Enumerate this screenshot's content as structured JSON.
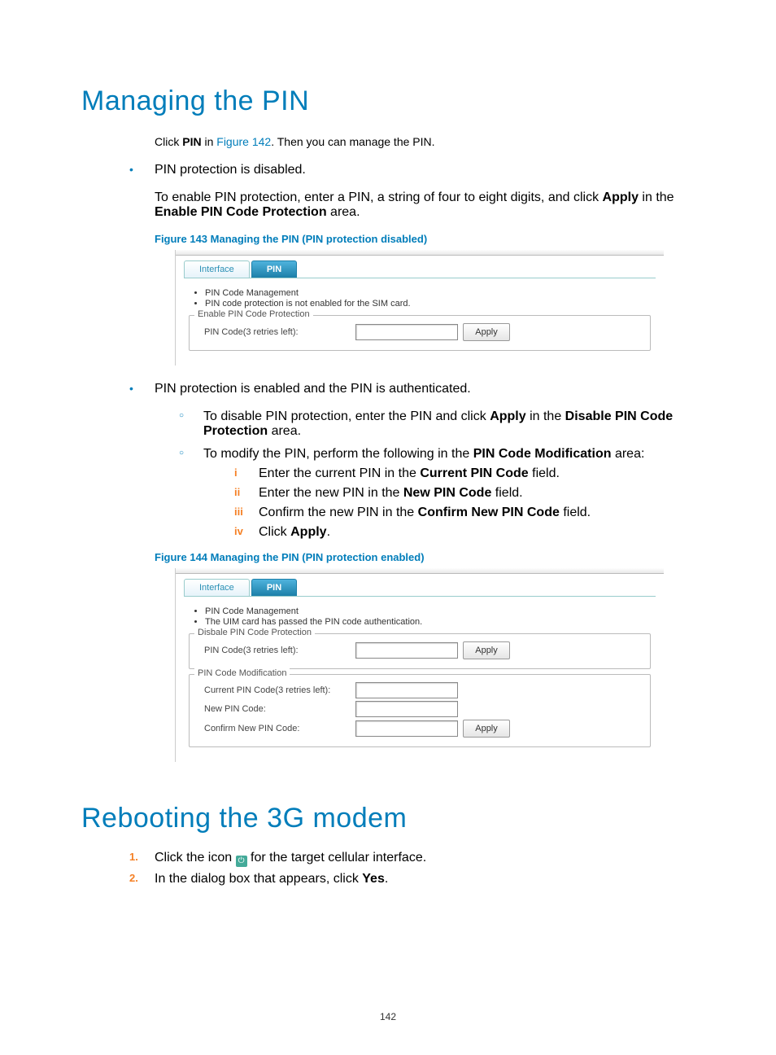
{
  "heading1": "Managing the PIN",
  "intro_parts": {
    "a": "Click ",
    "b_bold": "PIN",
    "c": " in ",
    "d_link": "Figure 142",
    "e": ". Then you can manage the PIN."
  },
  "bullet1": "PIN protection is disabled.",
  "enable_parts": {
    "a": "To enable PIN protection, enter a PIN, a string of four to eight digits, and click ",
    "b_bold": "Apply",
    "c": " in the ",
    "d_bold": "Enable PIN Code Protection",
    "e": " area."
  },
  "fig143": "Figure 143 Managing the PIN (PIN protection disabled)",
  "ui1": {
    "tab_interface": "Interface",
    "tab_pin": "PIN",
    "li1": "PIN Code Management",
    "li2": "PIN code protection is not enabled for the SIM card.",
    "legend_enable": "Enable PIN Code Protection",
    "label_pincode": "PIN Code(3 retries left):",
    "apply": "Apply"
  },
  "bullet2": "PIN protection is enabled and the PIN is authenticated.",
  "disable_parts": {
    "a": "To disable PIN protection, enter the PIN and click ",
    "b_bold": "Apply",
    "c": " in the ",
    "d_bold": "Disable PIN Code Protection",
    "e": " area."
  },
  "modify_parts": {
    "a": "To modify the PIN, perform the following in the ",
    "b_bold": "PIN Code Modification",
    "c": " area:"
  },
  "steps": {
    "i_num": "i",
    "i_a": "Enter the current PIN in the ",
    "i_b": "Current PIN Code",
    "i_c": " field.",
    "ii_num": "ii",
    "ii_a": "Enter the new PIN in the ",
    "ii_b": "New PIN Code",
    "ii_c": " field.",
    "iii_num": "iii",
    "iii_a": "Confirm the new PIN in the ",
    "iii_b": "Confirm New PIN Code",
    "iii_c": " field.",
    "iv_num": "iv",
    "iv_a": "Click ",
    "iv_b": "Apply",
    "iv_c": "."
  },
  "fig144": "Figure 144 Managing the PIN (PIN protection enabled)",
  "ui2": {
    "tab_interface": "Interface",
    "tab_pin": "PIN",
    "li1": "PIN Code Management",
    "li2": "The UIM card has passed the PIN code authentication.",
    "legend_disable": "Disbale PIN Code Protection",
    "label_pincode": "PIN Code(3 retries left):",
    "legend_mod": "PIN Code Modification",
    "label_current": "Current PIN Code(3 retries left):",
    "label_new": "New PIN Code:",
    "label_confirm": "Confirm New PIN Code:",
    "apply": "Apply"
  },
  "heading2": "Rebooting the 3G modem",
  "reboot": {
    "n1": "1.",
    "l1a": "Click the icon ",
    "l1b": " for the target cellular interface.",
    "n2": "2.",
    "l2a": "In the dialog box that appears, click ",
    "l2b": "Yes",
    "l2c": "."
  },
  "icon_glyph": "⏻",
  "page_number": "142"
}
